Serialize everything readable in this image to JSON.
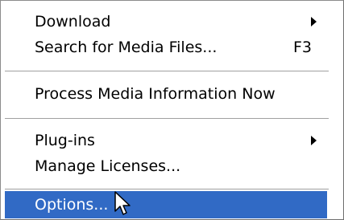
{
  "menu": {
    "items": [
      {
        "label": "Download",
        "shortcut": "",
        "submenu": true
      },
      {
        "label": "Search for Media Files...",
        "shortcut": "F3",
        "submenu": false
      },
      {
        "label": "Process Media Information Now",
        "shortcut": "",
        "submenu": false
      },
      {
        "label": "Plug-ins",
        "shortcut": "",
        "submenu": true
      },
      {
        "label": "Manage Licenses...",
        "shortcut": "",
        "submenu": false
      },
      {
        "label": "Options...",
        "shortcut": "",
        "submenu": false,
        "selected": true
      }
    ]
  },
  "colors": {
    "highlight": "#316ac5",
    "highlight_text": "#ffffff",
    "menu_bg": "#ffffff",
    "separator": "#a0a0a0"
  },
  "icons": {
    "submenu": "submenu-arrow-icon",
    "cursor": "mouse-pointer-icon"
  }
}
